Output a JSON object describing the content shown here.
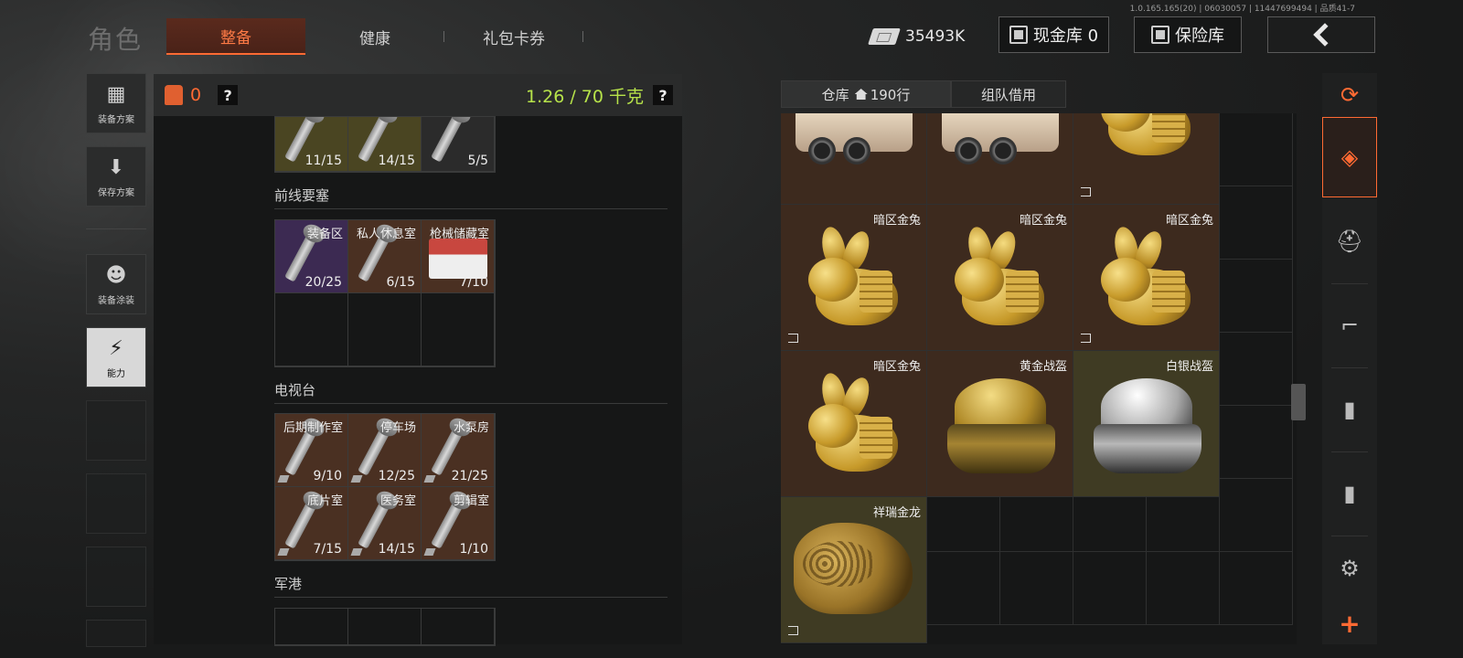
{
  "version": "1.0.165.165(20) | 06030057 | 11447699494 | 品质41-7",
  "header": {
    "title": "角色",
    "tabs": [
      {
        "label": "整备",
        "active": true
      },
      {
        "label": "健康",
        "active": false
      },
      {
        "label": "礼包卡券",
        "active": false
      }
    ],
    "currency": "35493K",
    "cash_vault_label": "现金库 0",
    "safe_label": "保险库"
  },
  "left_nav": [
    {
      "label": "装备方案",
      "icon": "vest-icon"
    },
    {
      "label": "保存方案",
      "icon": "download-icon"
    },
    {
      "label": "装备涂装",
      "icon": "soldier-icon"
    },
    {
      "label": "能力",
      "icon": "ability-icon",
      "active": true
    }
  ],
  "loadout": {
    "armor_value": "0",
    "help": "?",
    "weight": "1.26 / 70 千克",
    "top_row": [
      {
        "count": "11/15"
      },
      {
        "count": "14/15"
      },
      {
        "count": "5/5"
      }
    ],
    "sections": [
      {
        "title": "前线要塞",
        "items": [
          {
            "name": "装备区",
            "count": "20/25",
            "color": "#3c2a52"
          },
          {
            "name": "私人休息室",
            "count": "6/15",
            "color": "#4a3022"
          },
          {
            "name": "枪械储藏室",
            "count": "7/10",
            "color": "#4a3022"
          }
        ]
      },
      {
        "title": "电视台",
        "items": [
          {
            "name": "后期制作室",
            "count": "9/10"
          },
          {
            "name": "停车场",
            "count": "12/25"
          },
          {
            "name": "水泵房",
            "count": "21/25"
          },
          {
            "name": "底片室",
            "count": "7/15"
          },
          {
            "name": "医务室",
            "count": "14/15"
          },
          {
            "name": "剪辑室",
            "count": "1/10"
          }
        ]
      },
      {
        "title": "军港",
        "items": []
      }
    ]
  },
  "warehouse": {
    "tab_label": "仓库",
    "rows": "190行",
    "team_tab_label": "组队借用",
    "items": [
      {
        "name": "暗区金兔",
        "type": "rabbit"
      },
      {
        "name": "暗区金兔",
        "type": "rabbit"
      },
      {
        "name": "暗区金兔",
        "type": "rabbit"
      },
      {
        "name": "暗区金兔",
        "type": "rabbit"
      },
      {
        "name": "黄金战盔",
        "type": "helmet"
      },
      {
        "name": "白银战盔",
        "type": "helmet"
      },
      {
        "name": "祥瑞金龙",
        "type": "dragon"
      }
    ]
  },
  "filter_bar": {
    "icons": [
      "layers-refresh-icon",
      "layers-icon",
      "helmet-icon",
      "rifle-icon",
      "magazine-icon",
      "ammo-icon",
      "gear-icon",
      "plus-icon"
    ],
    "plus": "+"
  },
  "colors": {
    "accent": "#ff6a33",
    "weight": "#b7e34a",
    "brown_cell": "#3d2a1e",
    "olive_cell": "#3f3b23"
  }
}
